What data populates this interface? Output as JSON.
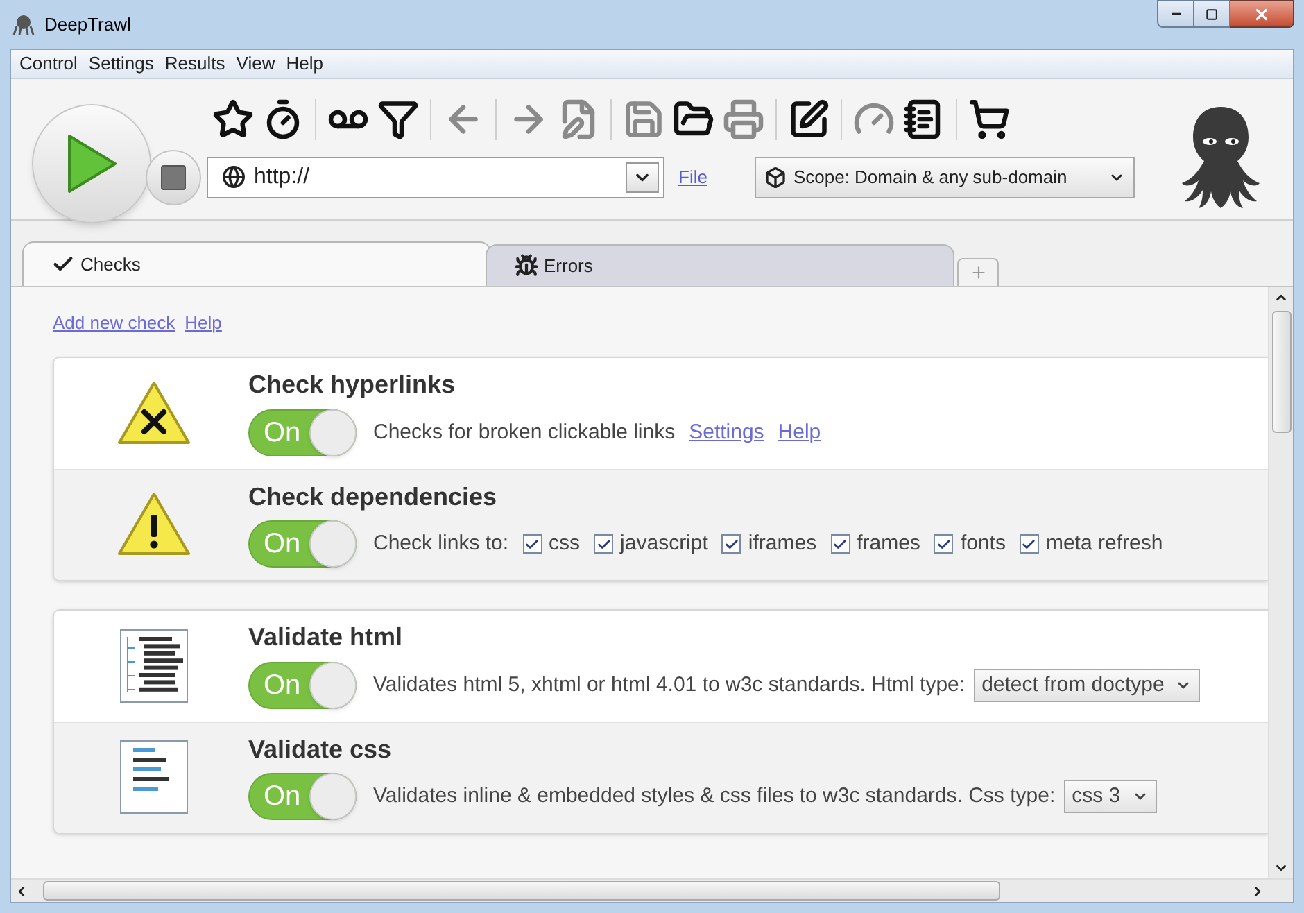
{
  "window": {
    "title": "DeepTrawl"
  },
  "menu": [
    "Control",
    "Settings",
    "Results",
    "View",
    "Help"
  ],
  "toolbar": {
    "buttons": [
      {
        "kind": "star",
        "disabled": false
      },
      {
        "kind": "timer",
        "disabled": false
      },
      {
        "kind": "tape",
        "disabled": false
      },
      {
        "kind": "filter",
        "disabled": false
      },
      {
        "kind": "back",
        "disabled": true
      },
      {
        "kind": "forward",
        "disabled": true
      },
      {
        "kind": "save-as",
        "disabled": true
      },
      {
        "kind": "save",
        "disabled": true
      },
      {
        "kind": "open",
        "disabled": false
      },
      {
        "kind": "print",
        "disabled": true
      },
      {
        "kind": "edit",
        "disabled": false
      },
      {
        "kind": "gauge",
        "disabled": true
      },
      {
        "kind": "notebook",
        "disabled": false
      },
      {
        "kind": "cart",
        "disabled": false
      }
    ],
    "url": {
      "value": "http://"
    },
    "file_link": "File",
    "scope": {
      "value": "Scope: Domain & any sub-domain"
    }
  },
  "tabs": [
    {
      "label": "Checks",
      "kind": "check",
      "selected": true
    },
    {
      "label": "Errors",
      "kind": "bug",
      "selected": false
    }
  ],
  "links": [
    "Add new check",
    "Help"
  ],
  "groups": [
    [
      {
        "title": "Check hyperlinks",
        "kind": "warning-x",
        "on": true,
        "switch_label": "On",
        "description": "Checks for broken clickable links",
        "links": [
          "Settings",
          "Help"
        ]
      },
      {
        "title": "Check dependencies",
        "kind": "warning",
        "on": true,
        "switch_label": "On",
        "description": "Check links to:",
        "options": [
          {
            "label": "css",
            "checked": true
          },
          {
            "label": "javascript",
            "checked": true
          },
          {
            "label": "iframes",
            "checked": true
          },
          {
            "label": "frames",
            "checked": true
          },
          {
            "label": "fonts",
            "checked": true
          },
          {
            "label": "meta refresh",
            "checked": true
          }
        ]
      }
    ],
    [
      {
        "title": "Validate html",
        "kind": "html",
        "on": true,
        "switch_label": "On",
        "description": "Validates html 5, xhtml or html 4.01 to w3c standards. Html type:",
        "select": {
          "value": "detect from doctype"
        }
      },
      {
        "title": "Validate css",
        "kind": "css",
        "on": true,
        "switch_label": "On",
        "description": "Validates inline & embedded styles & css files to w3c standards. Css type:",
        "select": {
          "value": "css 3"
        }
      }
    ]
  ]
}
